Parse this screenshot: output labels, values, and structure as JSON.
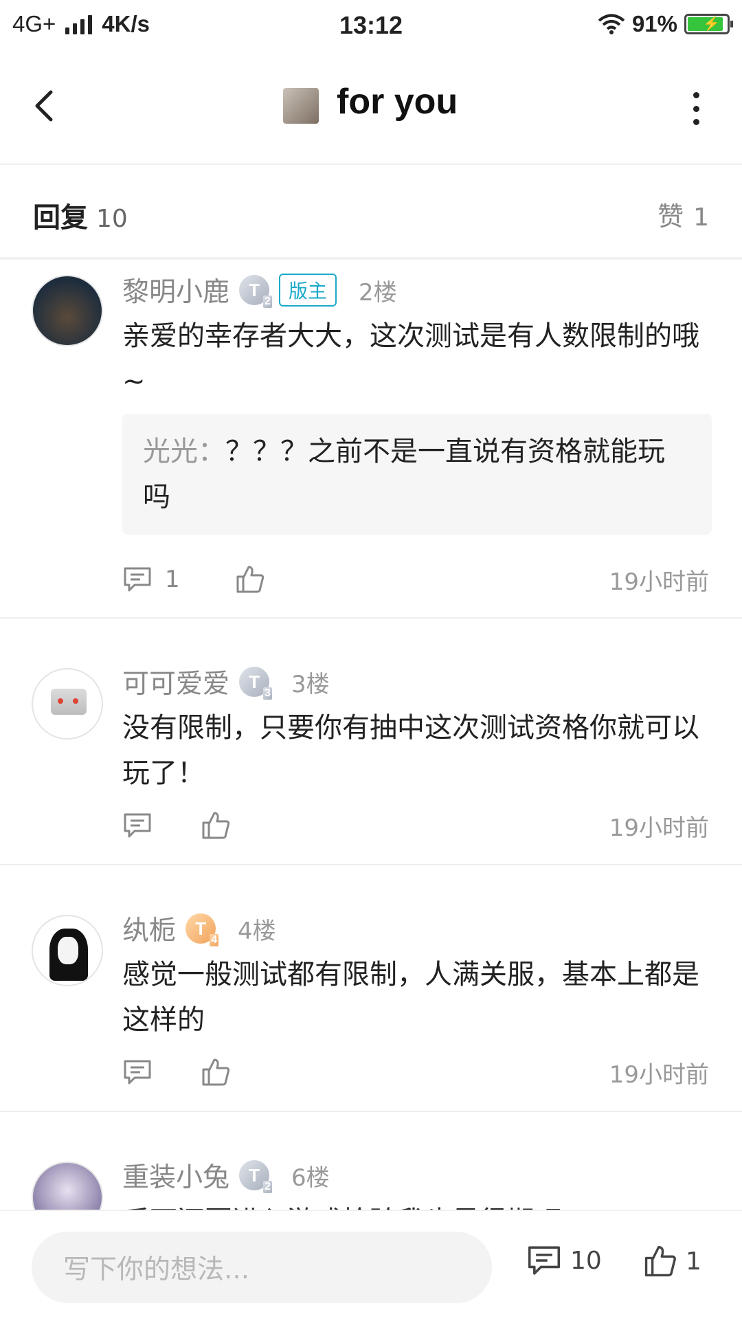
{
  "status_bar": {
    "network": "4G+",
    "speed": "4K/s",
    "time": "13:12",
    "battery": "91%",
    "battery_level": 0.91,
    "battery_color": "#35c43c"
  },
  "header": {
    "title": "for you"
  },
  "stats": {
    "reply_label": "回复",
    "reply_count": "10",
    "like_label": "赞",
    "like_count": "1"
  },
  "comments": [
    {
      "name": "黎明小鹿",
      "level": "T",
      "level_num": "2",
      "badge": "版主",
      "floor": "2楼",
      "text": "亲爱的幸存者大大，这次测试是有人数限制的哦~",
      "quote_name": "光光：",
      "quote_text": "？？？之前不是一直说有资格就能玩吗",
      "reply_count": "1",
      "time": "19小时前"
    },
    {
      "name": "可可爱爱",
      "level": "T",
      "level_num": "3",
      "floor": "3楼",
      "text": "没有限制，只要你有抽中这次测试资格你就可以玩了！",
      "time": "19小时前"
    },
    {
      "name": "纨栀",
      "level": "T",
      "level_num": "4",
      "floor": "4楼",
      "text": "感觉一般测试都有限制，人满关服，基本上都是这样的",
      "time": "19小时前"
    },
    {
      "name": "重装小兔",
      "level": "T",
      "level_num": "2",
      "floor": "6楼",
      "text": "后面还要进入游戏检验我也是很期吧"
    }
  ],
  "bottom_bar": {
    "placeholder": "写下你的想法...",
    "comment_count": "10",
    "like_count": "1"
  }
}
